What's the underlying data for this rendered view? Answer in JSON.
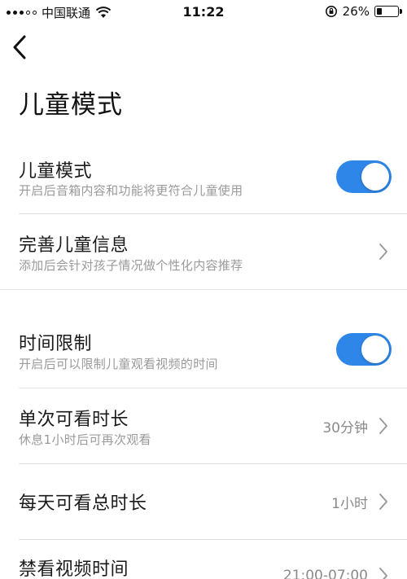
{
  "status_bar": {
    "carrier": "中国联通",
    "time": "11:22",
    "battery_percent": "26%",
    "battery_level": 0.26
  },
  "page": {
    "title": "儿童模式"
  },
  "settings": [
    {
      "title": "儿童模式",
      "subtitle": "开启后音箱内容和功能将更符合儿童使用",
      "control": "toggle",
      "on": true
    },
    {
      "title": "完善儿童信息",
      "subtitle": "添加后会针对孩子情况做个性化内容推荐",
      "control": "chevron"
    },
    {
      "title": "时间限制",
      "subtitle": "开启后可以限制儿童观看视频的时间",
      "control": "toggle",
      "on": true
    },
    {
      "title": "单次可看时长",
      "subtitle": "休息1小时后可再次观看",
      "value": "30分钟",
      "control": "chevron"
    },
    {
      "title": "每天可看总时长",
      "value": "1小时",
      "control": "chevron"
    },
    {
      "title": "禁看视频时间",
      "value": "21:00-07:00",
      "control": "chevron"
    }
  ],
  "colors": {
    "accent": "#2e86e8",
    "subtitle": "#9a9a9a",
    "divider": "#e3e3e3"
  },
  "icons": [
    "back-arrow-icon",
    "wifi-icon",
    "rotation-lock-icon",
    "battery-icon",
    "chevron-right-icon"
  ]
}
